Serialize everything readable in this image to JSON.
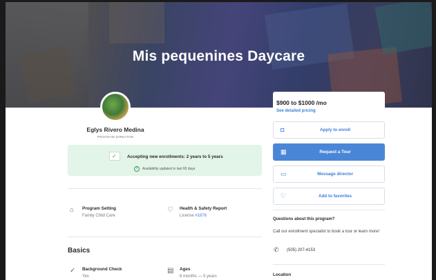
{
  "hero": {
    "title": "Mis pequenines Daycare"
  },
  "director": {
    "name": "Eglys Rivero Medina",
    "role": "PROGRAM DIRECTOR"
  },
  "enrollment": {
    "status": "Accepting new enrollments: 2 years to 5 years",
    "updated": "Availability updated in last 60 days"
  },
  "features": {
    "setting": {
      "title": "Program Setting",
      "value": "Family Child Care"
    },
    "health": {
      "title": "Health & Safety Report",
      "prefix": "License ",
      "link": "#1876"
    }
  },
  "basics": {
    "title": "Basics",
    "background": {
      "title": "Background Check",
      "value": "Yes"
    },
    "ages": {
      "title": "Ages",
      "value": "6 months — 5 years"
    }
  },
  "pricing": {
    "price": "$900 to $1000 /mo",
    "link": "See detailed pricing"
  },
  "actions": {
    "apply": "Apply to enroll",
    "tour": "Request a Tour",
    "message": "Message director",
    "favorite": "Add to favorites"
  },
  "contact": {
    "question": "Questions about this program?",
    "text": "Call our enrollment specialist to book a tour or learn more!",
    "phone": "(505) 207-4153"
  },
  "location": {
    "title": "Location"
  },
  "icons": {
    "check": "✓",
    "home": "⌂",
    "shield": "♡",
    "calendar": "▦",
    "chat": "▭",
    "heart": "♡",
    "bag": "◘",
    "phone": "✆",
    "building": "▤",
    "badge": "✓"
  }
}
